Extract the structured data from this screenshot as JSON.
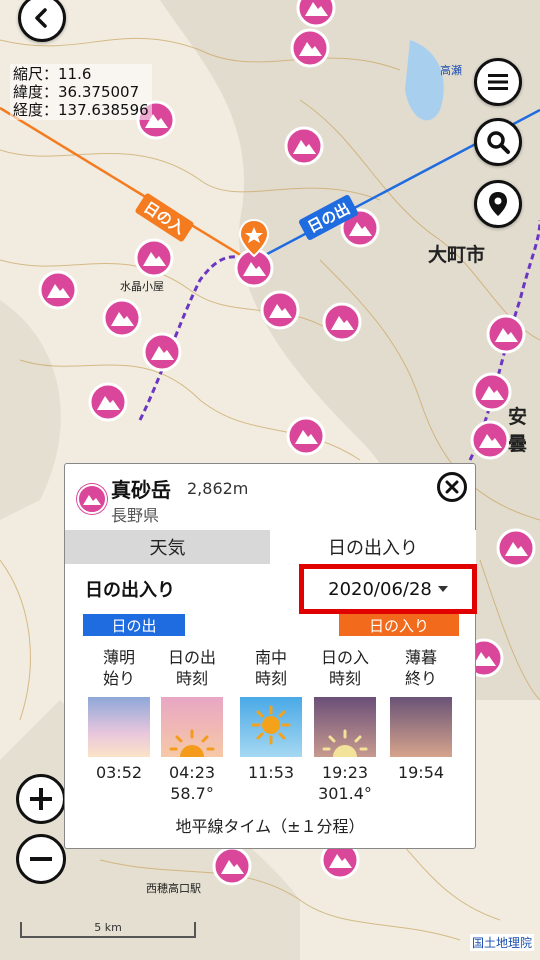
{
  "map": {
    "scale_label": "縮尺：11.6",
    "lat_label": "緯度：36.375007",
    "lon_label": "経度：137.638596",
    "sunset_line_label": "日の入",
    "sunrise_line_label": "日の出",
    "place_omachi": "大町市",
    "place_azumi": "安曇",
    "place_takase": "高瀬",
    "place_suisho": "水晶小屋",
    "place_nishiho": "西穂高口駅",
    "scale_bar": "5 km",
    "attribution": "国土地理院",
    "colors": {
      "sunset_line": "#f47b20",
      "sunrise_line": "#1f6be0",
      "peak_marker": "#d9469a"
    }
  },
  "controls": {
    "back_icon": "chevron-left-icon",
    "menu_icon": "hamburger-icon",
    "search_icon": "search-icon",
    "location_icon": "location-pin-icon",
    "zoom_in_icon": "plus-icon",
    "zoom_out_icon": "minus-icon"
  },
  "popup": {
    "name": "真砂岳",
    "elevation": "2,862m",
    "prefecture": "長野県",
    "tabs": [
      "天気",
      "日の出入り"
    ],
    "active_tab": 1,
    "section_label": "日の出入り",
    "date": "2020/06/28",
    "sunrise_badge": "日の出",
    "sunset_badge": "日の入り",
    "columns": [
      {
        "header_l1": "薄明",
        "header_l2": "始り",
        "time": "03:52",
        "azimuth": ""
      },
      {
        "header_l1": "日の出",
        "header_l2": "時刻",
        "time": "04:23",
        "azimuth": "58.7°"
      },
      {
        "header_l1": "南中",
        "header_l2": "時刻",
        "time": "11:53",
        "azimuth": ""
      },
      {
        "header_l1": "日の入",
        "header_l2": "時刻",
        "time": "19:23",
        "azimuth": "301.4°"
      },
      {
        "header_l1": "薄暮",
        "header_l2": "終り",
        "time": "19:54",
        "azimuth": ""
      }
    ],
    "note": "地平線タイム（±１分程）"
  }
}
